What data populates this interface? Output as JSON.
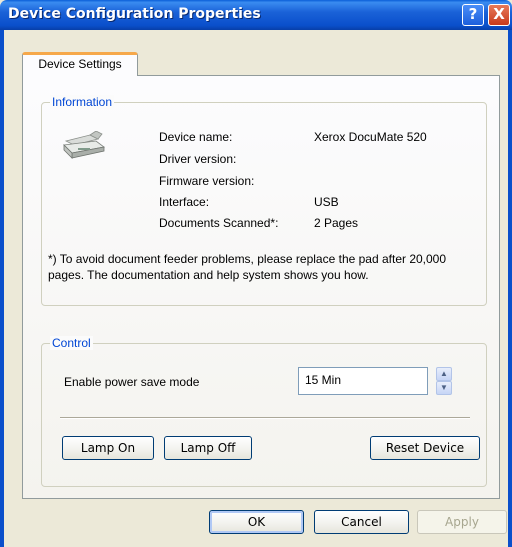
{
  "window": {
    "title": "Device Configuration Properties",
    "help_glyph": "?",
    "close_glyph": "X"
  },
  "tabs": [
    {
      "label": "Device Settings",
      "selected": true
    }
  ],
  "information": {
    "group_label": "Information",
    "icon": "scanner-icon",
    "rows": [
      {
        "label": "Device name:",
        "value": "Xerox DocuMate 520"
      },
      {
        "label": "Driver version:",
        "value": ""
      },
      {
        "label": "Firmware version:",
        "value": ""
      },
      {
        "label": "Interface:",
        "value": "USB"
      },
      {
        "label": "Documents Scanned*:",
        "value": "2 Pages"
      }
    ],
    "note": "*)  To avoid document feeder problems, please replace the pad after 20,000 pages. The documentation and help system shows you how."
  },
  "control": {
    "group_label": "Control",
    "power_save_label": "Enable power save mode",
    "power_save_value": "15 Min",
    "spin_up": "▲",
    "spin_down": "▼",
    "lamp_on": "Lamp On",
    "lamp_off": "Lamp Off",
    "reset_device": "Reset Device"
  },
  "footer": {
    "ok": "OK",
    "cancel": "Cancel",
    "apply": "Apply"
  },
  "colors": {
    "titlebar": "#0a4fcb",
    "group_label": "#0046d5",
    "tab_accent": "#f6a84a"
  }
}
